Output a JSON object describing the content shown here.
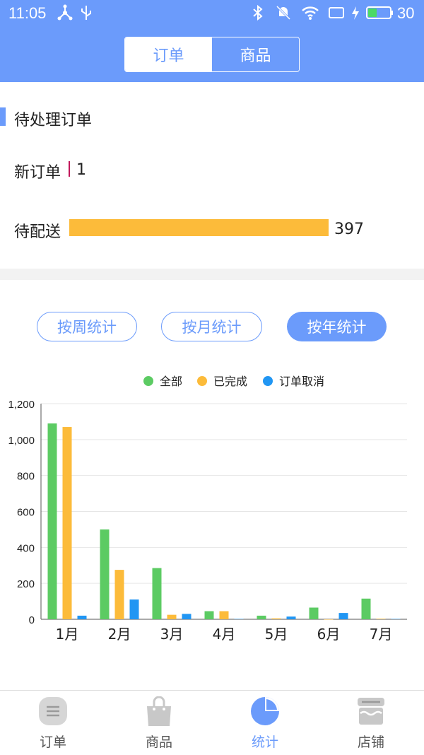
{
  "status_bar": {
    "time": "11:05",
    "battery": "30"
  },
  "header": {
    "tabs": [
      {
        "label": "订单",
        "active": true
      },
      {
        "label": "商品",
        "active": false
      }
    ]
  },
  "pending": {
    "title": "待处理订单",
    "rows": [
      {
        "label": "新订单",
        "value": "1"
      },
      {
        "label": "待配送",
        "value": "397"
      }
    ],
    "bar_color": "#fcbb3a"
  },
  "filters": [
    {
      "label": "按周统计",
      "active": false
    },
    {
      "label": "按月统计",
      "active": false
    },
    {
      "label": "按年统计",
      "active": true
    }
  ],
  "chart_data": {
    "type": "bar",
    "categories": [
      "1月",
      "2月",
      "3月",
      "4月",
      "5月",
      "6月",
      "7月"
    ],
    "series": [
      {
        "name": "全部",
        "color": "#5ccb63",
        "values": [
          1090,
          500,
          285,
          45,
          20,
          65,
          115
        ]
      },
      {
        "name": "已完成",
        "color": "#fcbb3a",
        "values": [
          1070,
          275,
          25,
          45,
          5,
          0,
          3
        ]
      },
      {
        "name": "订单取消",
        "color": "#2196f3",
        "values": [
          20,
          110,
          30,
          2,
          15,
          35,
          2
        ]
      }
    ],
    "yticks": [
      "0",
      "200",
      "400",
      "600",
      "800",
      "1,000",
      "1,200"
    ],
    "ylim": [
      0,
      1200
    ],
    "legend": "top-center",
    "grid": true
  },
  "tabbar": {
    "items": [
      {
        "label": "订单",
        "icon": "list-icon",
        "active": false
      },
      {
        "label": "商品",
        "icon": "shopping-bag-icon",
        "active": false
      },
      {
        "label": "统计",
        "icon": "pie-chart-icon",
        "active": true
      },
      {
        "label": "店铺",
        "icon": "store-icon",
        "active": false
      }
    ]
  },
  "colors": {
    "accent": "#6b9bfb",
    "inactive_icon": "#c8c8c8"
  }
}
